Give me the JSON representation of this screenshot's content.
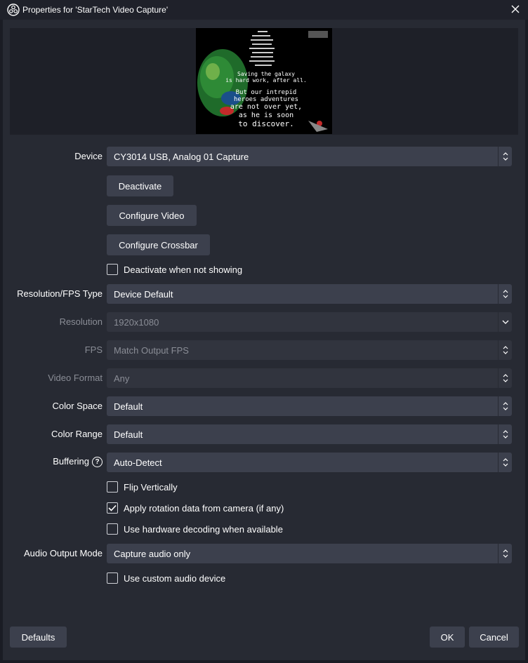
{
  "window": {
    "title": "Properties for 'StarTech Video Capture'"
  },
  "preview": {
    "caption_lines": [
      "Saving the galaxy",
      "is hard work, after all.",
      "But our intrepid",
      "heroes adventures",
      "are not over yet,",
      "as he is soon",
      "to discover."
    ]
  },
  "device": {
    "label": "Device",
    "value": "CY3014 USB, Analog 01 Capture"
  },
  "buttons": {
    "deactivate": "Deactivate",
    "configure_video": "Configure Video",
    "configure_crossbar": "Configure Crossbar",
    "defaults": "Defaults",
    "ok": "OK",
    "cancel": "Cancel"
  },
  "checks": {
    "deactivate_when_not_showing": {
      "label": "Deactivate when not showing",
      "checked": false
    },
    "flip_vertically": {
      "label": "Flip Vertically",
      "checked": false
    },
    "apply_rotation": {
      "label": "Apply rotation data from camera (if any)",
      "checked": true
    },
    "hw_decoding": {
      "label": "Use hardware decoding when available",
      "checked": false
    },
    "custom_audio_device": {
      "label": "Use custom audio device",
      "checked": false
    }
  },
  "fields": {
    "res_fps_type": {
      "label": "Resolution/FPS Type",
      "value": "Device Default"
    },
    "resolution": {
      "label": "Resolution",
      "value": "1920x1080"
    },
    "fps": {
      "label": "FPS",
      "value": "Match Output FPS"
    },
    "video_format": {
      "label": "Video Format",
      "value": "Any"
    },
    "color_space": {
      "label": "Color Space",
      "value": "Default"
    },
    "color_range": {
      "label": "Color Range",
      "value": "Default"
    },
    "buffering": {
      "label": "Buffering",
      "value": "Auto-Detect"
    },
    "audio_output_mode": {
      "label": "Audio Output Mode",
      "value": "Capture audio only"
    }
  },
  "icons": {
    "app": "obs-logo-icon",
    "close": "close-icon",
    "help": "help-icon",
    "spinner": "up-down-arrows-icon",
    "dropdown": "chevron-down-icon",
    "check": "checkmark-icon"
  },
  "colors": {
    "background": "#272a33",
    "titlebar": "#1f212a",
    "control": "#3c404d",
    "control_disabled": "#31343e",
    "text_disabled": "#8a8d96"
  }
}
